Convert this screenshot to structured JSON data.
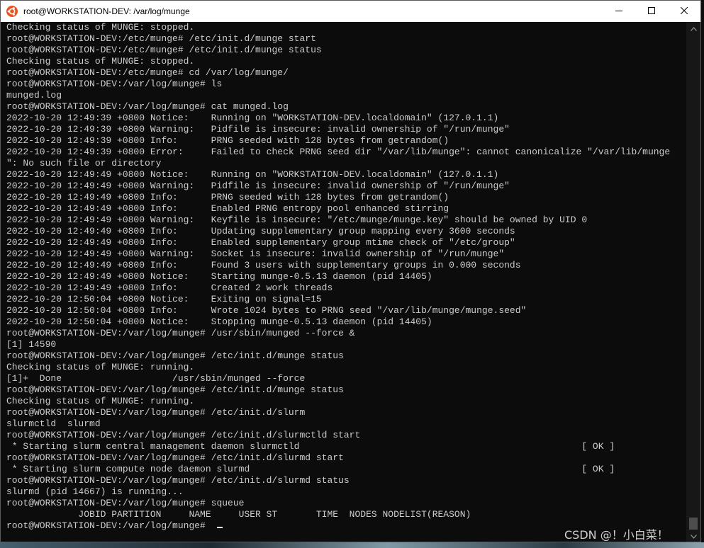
{
  "window": {
    "title": "root@WORKSTATION-DEV: /var/log/munge",
    "app_icon": "ubuntu-icon",
    "accent_color": "#e95420"
  },
  "controls": {
    "minimize_icon": "minimize-icon",
    "maximize_icon": "maximize-icon",
    "close_icon": "close-icon"
  },
  "terminal": {
    "background": "#0c0c0c",
    "foreground": "#cccccc",
    "lines": [
      "Checking status of MUNGE: stopped.",
      "root@WORKSTATION-DEV:/etc/munge# /etc/init.d/munge start",
      "root@WORKSTATION-DEV:/etc/munge# /etc/init.d/munge status",
      "Checking status of MUNGE: stopped.",
      "root@WORKSTATION-DEV:/etc/munge# cd /var/log/munge/",
      "root@WORKSTATION-DEV:/var/log/munge# ls",
      "munged.log",
      "root@WORKSTATION-DEV:/var/log/munge# cat munged.log",
      "2022-10-20 12:49:39 +0800 Notice:    Running on \"WORKSTATION-DEV.localdomain\" (127.0.1.1)",
      "2022-10-20 12:49:39 +0800 Warning:   Pidfile is insecure: invalid ownership of \"/run/munge\"",
      "2022-10-20 12:49:39 +0800 Info:      PRNG seeded with 128 bytes from getrandom()",
      "2022-10-20 12:49:39 +0800 Error:     Failed to check PRNG seed dir \"/var/lib/munge\": cannot canonicalize \"/var/lib/munge",
      "\": No such file or directory",
      "2022-10-20 12:49:49 +0800 Notice:    Running on \"WORKSTATION-DEV.localdomain\" (127.0.1.1)",
      "2022-10-20 12:49:49 +0800 Warning:   Pidfile is insecure: invalid ownership of \"/run/munge\"",
      "2022-10-20 12:49:49 +0800 Info:      PRNG seeded with 128 bytes from getrandom()",
      "2022-10-20 12:49:49 +0800 Info:      Enabled PRNG entropy pool enhanced stirring",
      "2022-10-20 12:49:49 +0800 Warning:   Keyfile is insecure: \"/etc/munge/munge.key\" should be owned by UID 0",
      "2022-10-20 12:49:49 +0800 Info:      Updating supplementary group mapping every 3600 seconds",
      "2022-10-20 12:49:49 +0800 Info:      Enabled supplementary group mtime check of \"/etc/group\"",
      "2022-10-20 12:49:49 +0800 Warning:   Socket is insecure: invalid ownership of \"/run/munge\"",
      "2022-10-20 12:49:49 +0800 Info:      Found 3 users with supplementary groups in 0.000 seconds",
      "2022-10-20 12:49:49 +0800 Notice:    Starting munge-0.5.13 daemon (pid 14405)",
      "2022-10-20 12:49:49 +0800 Info:      Created 2 work threads",
      "2022-10-20 12:50:04 +0800 Notice:    Exiting on signal=15",
      "2022-10-20 12:50:04 +0800 Info:      Wrote 1024 bytes to PRNG seed \"/var/lib/munge/munge.seed\"",
      "2022-10-20 12:50:04 +0800 Notice:    Stopping munge-0.5.13 daemon (pid 14405)",
      "root@WORKSTATION-DEV:/var/log/munge# /usr/sbin/munged --force &",
      "[1] 14590",
      "root@WORKSTATION-DEV:/var/log/munge# /etc/init.d/munge status",
      "Checking status of MUNGE: running.",
      "[1]+  Done                    /usr/sbin/munged --force",
      "root@WORKSTATION-DEV:/var/log/munge# /etc/init.d/munge status",
      "Checking status of MUNGE: running.",
      "root@WORKSTATION-DEV:/var/log/munge# /etc/init.d/slurm",
      "slurmctld  slurmd",
      "root@WORKSTATION-DEV:/var/log/munge# /etc/init.d/slurmctld start",
      " * Starting slurm central management daemon slurmctld                                                   [ OK ]",
      "root@WORKSTATION-DEV:/var/log/munge# /etc/init.d/slurmd start",
      " * Starting slurm compute node daemon slurmd                                                            [ OK ]",
      "root@WORKSTATION-DEV:/var/log/munge# /etc/init.d/slurmd status",
      "slurmd (pid 14667) is running...",
      "root@WORKSTATION-DEV:/var/log/munge# squeue",
      "             JOBID PARTITION     NAME     USER ST       TIME  NODES NODELIST(REASON)",
      "root@WORKSTATION-DEV:/var/log/munge# "
    ]
  },
  "scrollbar": {
    "up_icon": "scroll-up-icon",
    "down_icon": "scroll-down-icon"
  },
  "watermark": {
    "text": "CSDN @！小白菜！"
  }
}
